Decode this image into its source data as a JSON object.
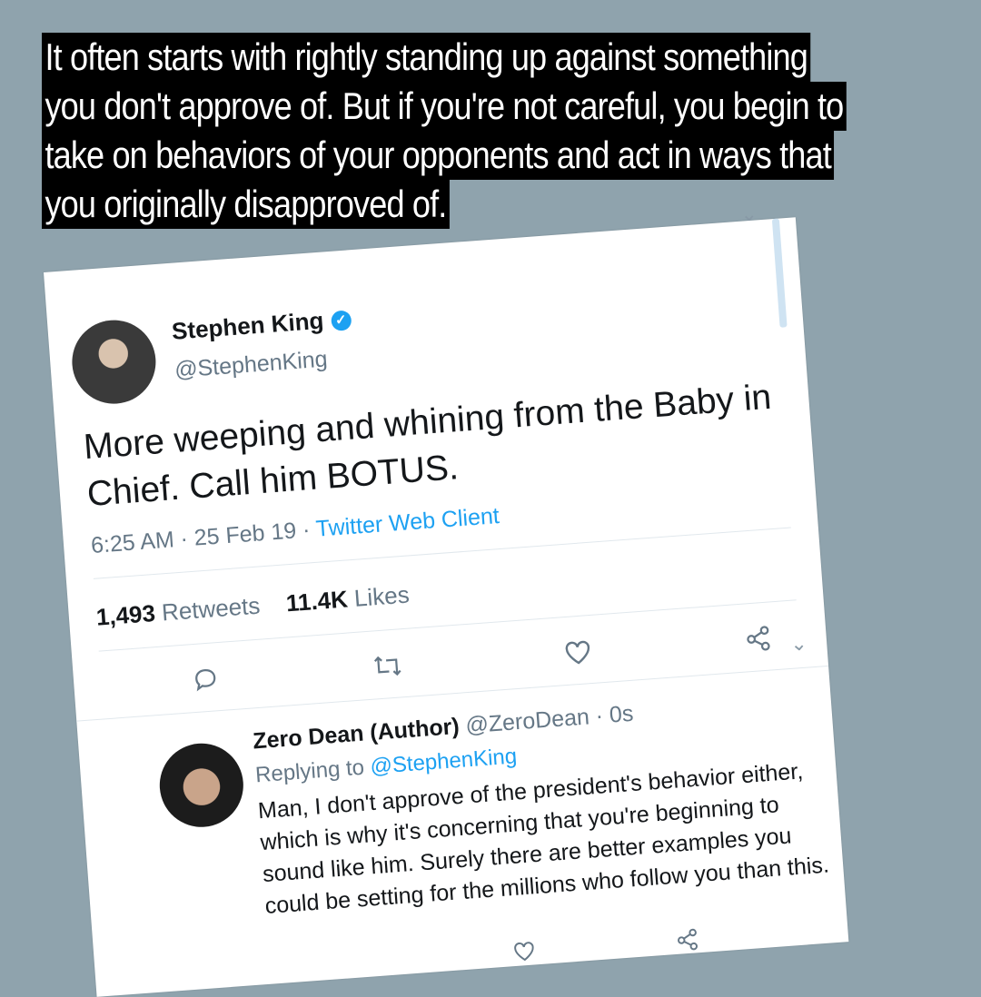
{
  "caption": {
    "lines": [
      "It often starts with rightly standing up against something",
      "you don't approve of. But if you're not careful, you begin to",
      "take on behaviors of your opponents and act in ways that",
      "you originally disapproved of."
    ]
  },
  "tweet": {
    "name": "Stephen King",
    "handle": "@StephenKing",
    "text": "More weeping and whining from the Baby in Chief. Call him BOTUS.",
    "time": "6:25 AM · 25 Feb 19 · ",
    "client": "Twitter Web Client",
    "retweets_count": "1,493",
    "retweets_label": " Retweets",
    "likes_count": "11.4K",
    "likes_label": " Likes"
  },
  "reply": {
    "name": "Zero Dean (Author)",
    "handle_time": " @ZeroDean · 0s",
    "replying_prefix": "Replying to ",
    "replying_to": "@StephenKing",
    "text": "Man, I don't approve of the president's behavior either, which is why it's concerning that you're beginning to sound like him. Surely there are better examples you could be setting for the millions who follow you than this."
  },
  "icons": {
    "chevron": "chevron-down-icon",
    "verified": "verified-badge-icon",
    "reply": "reply-icon",
    "retweet": "retweet-icon",
    "like": "heart-icon",
    "share": "share-icon"
  },
  "colors": {
    "background": "#8fa3ad",
    "accent": "#1da1f2",
    "caption_bg": "#000000",
    "caption_text": "#ffffff"
  }
}
